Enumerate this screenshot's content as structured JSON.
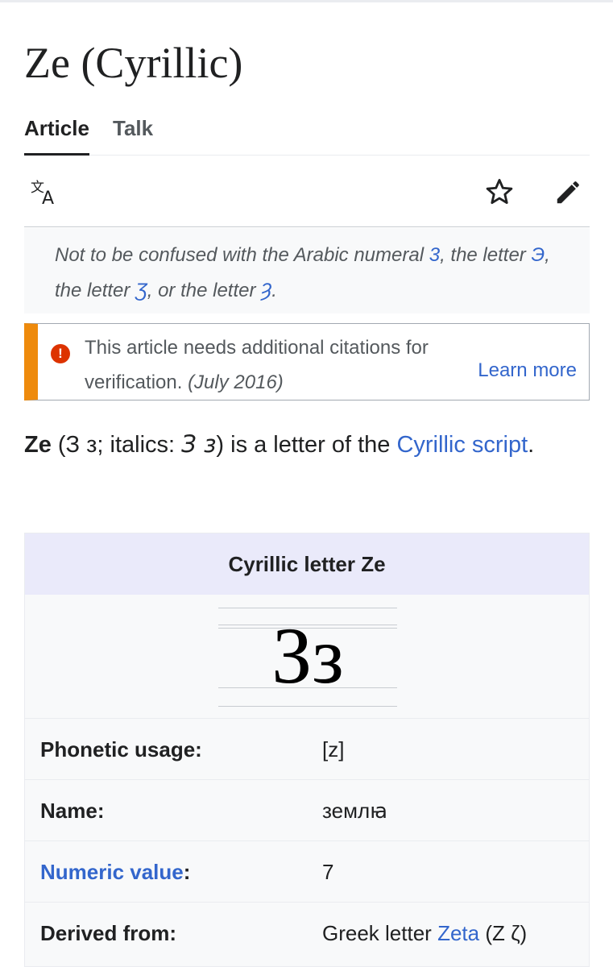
{
  "page": {
    "title": "Ze (Cyrillic)"
  },
  "tabs": [
    {
      "label": "Article",
      "active": true
    },
    {
      "label": "Talk",
      "active": false
    }
  ],
  "toolbar": {
    "icons": [
      "translate-icon",
      "star-icon",
      "pencil-icon"
    ]
  },
  "hatnote": {
    "t1": "Not to be confused with the Arabic numeral ",
    "l1": "3",
    "t2": ", the letter ",
    "l2": "Э",
    "t3": ", the letter ",
    "l3": "Ʒ",
    "t4": ", or the letter ",
    "l4": "Ȝ",
    "t5": "."
  },
  "ambox": {
    "icon": "warning-icon",
    "message": "This article needs additional citations for verification.",
    "date": "(July 2016)",
    "learn_more": "Learn more"
  },
  "lead": {
    "bold": "Ze",
    "t1": " (З з; italics: ",
    "italics": "З з",
    "t2": ") is a letter of the ",
    "link": "Cyrillic script",
    "t3": "."
  },
  "infobox": {
    "title": "Cyrillic letter Ze",
    "glyph": "Зз",
    "rows": [
      {
        "label": "Phonetic usage:",
        "value": "[z]"
      },
      {
        "label": "Name:",
        "value": "землꙗ"
      },
      {
        "label": "Numeric value",
        "colon": ":",
        "value": "7"
      },
      {
        "label": "Derived from:",
        "value_prefix": "Greek letter ",
        "value_link": "Zeta",
        "value_suffix": " (Ζ ζ)"
      }
    ]
  },
  "colors": {
    "link": "#3366cc",
    "ambox_stripe": "#ee8a0c",
    "warning": "#dd3300",
    "infobox_header": "#eaeafa"
  }
}
